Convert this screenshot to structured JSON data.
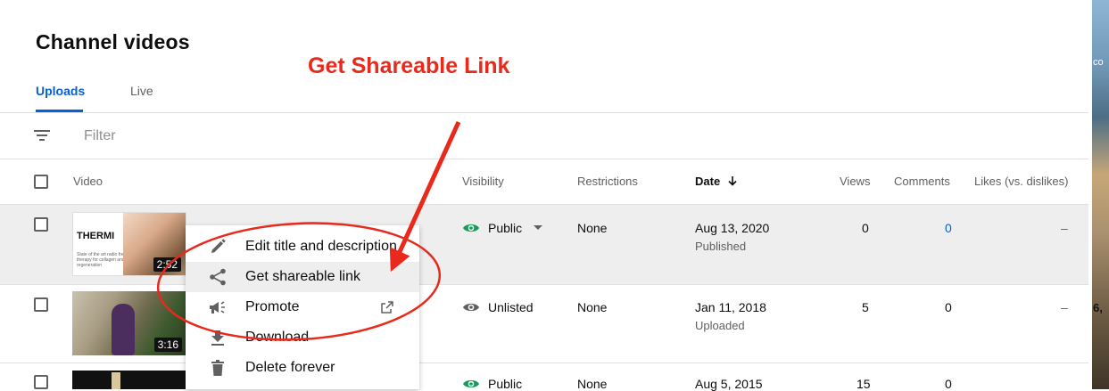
{
  "page": {
    "title": "Channel videos"
  },
  "annotation": {
    "text": "Get Shareable Link",
    "color": "#e8291b"
  },
  "tabs": [
    {
      "label": "Uploads",
      "active": true
    },
    {
      "label": "Live",
      "active": false
    }
  ],
  "filter": {
    "placeholder": "Filter"
  },
  "columns": [
    "Video",
    "Visibility",
    "Restrictions",
    "Date",
    "Views",
    "Comments",
    "Likes (vs. dislikes)"
  ],
  "rows": [
    {
      "thumb_title": "THERMI",
      "thumb_caption": "State of the art radio frequency therapy for collagen and tissue regeneration",
      "duration": "2:52",
      "visibility": "Public",
      "restrictions": "None",
      "date": "Aug 13, 2020",
      "status": "Published",
      "views": "0",
      "comments": "0",
      "likes": "–"
    },
    {
      "duration": "3:16",
      "visibility": "Unlisted",
      "restrictions": "None",
      "date": "Jan 11, 2018",
      "status": "Uploaded",
      "views": "5",
      "comments": "0",
      "likes": "–"
    },
    {
      "visibility": "Public",
      "restrictions": "None",
      "date": "Aug 5, 2015",
      "views": "15",
      "comments": "0"
    }
  ],
  "context_menu": {
    "items": [
      {
        "label": "Edit title and description",
        "icon": "pencil-icon"
      },
      {
        "label": "Get shareable link",
        "icon": "share-icon",
        "highlighted": true
      },
      {
        "label": "Promote",
        "icon": "megaphone-icon",
        "external": true
      },
      {
        "label": "Download",
        "icon": "download-icon"
      },
      {
        "label": "Delete forever",
        "icon": "trash-icon"
      }
    ]
  },
  "right_strip": {
    "text_top": "co",
    "text_mid": "6,"
  },
  "colors": {
    "accent": "#065fd4",
    "public_green": "#0f9d58",
    "annotation_red": "#e8291b"
  }
}
